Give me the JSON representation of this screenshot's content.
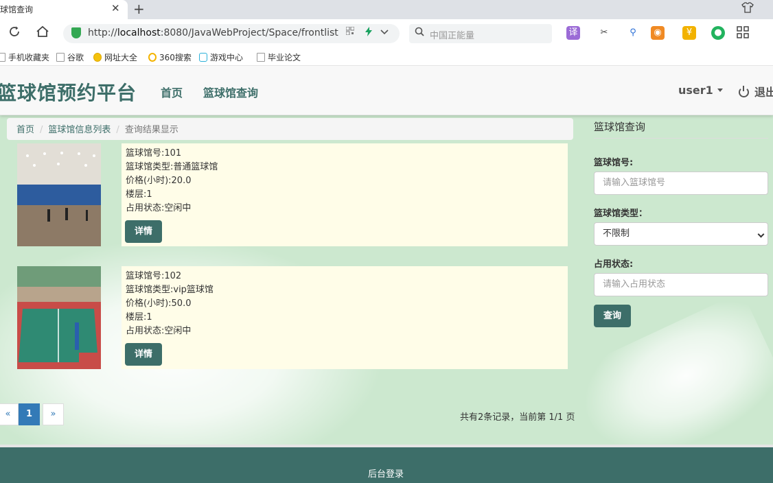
{
  "browser": {
    "tab_title": "球馆查询",
    "close_glyph": "✕",
    "new_tab_glyph": "+",
    "url_prefix": "http://",
    "url_host": "localhost",
    "url_rest": ":8080/JavaWebProject/Space/frontlist",
    "search_placeholder": "中国正能量",
    "bookmarks": [
      "手机收藏夹",
      "谷歌",
      "网址大全",
      "360搜索",
      "游戏中心",
      "毕业论文"
    ]
  },
  "header": {
    "brand": "篮球馆预约平台",
    "nav": [
      "首页",
      "篮球馆查询"
    ],
    "user": "user1",
    "logout": "退出"
  },
  "breadcrumb": {
    "items": [
      "首页",
      "篮球馆信息列表"
    ],
    "current": "查询结果显示",
    "separator": "/"
  },
  "results": [
    {
      "number": "篮球馆号:101",
      "type": "篮球馆类型:普通篮球馆",
      "price": "价格(小时):20.0",
      "floor": "楼层:1",
      "status": "占用状态:空闲中",
      "button": "详情"
    },
    {
      "number": "篮球馆号:102",
      "type": "篮球馆类型:vip篮球馆",
      "price": "价格(小时):50.0",
      "floor": "楼层:1",
      "status": "占用状态:空闲中",
      "button": "详情"
    }
  ],
  "pagination": {
    "prev": "«",
    "current": "1",
    "next": "»",
    "summary": "共有2条记录，当前第 1/1 页"
  },
  "sidebar": {
    "title": "篮球馆查询",
    "number_label": "篮球馆号:",
    "number_placeholder": "请输入篮球馆号",
    "type_label": "篮球馆类型：",
    "type_selected": "不限制",
    "status_label": "占用状态:",
    "status_placeholder": "请输入占用状态",
    "submit": "查询"
  },
  "footer": {
    "admin_link": "后台登录"
  },
  "colors": {
    "brand": "#3d6e69",
    "page_bg": "#cce8cf",
    "card_bg": "#fffde8",
    "pager_active": "#337ab7"
  },
  "icons": [
    "shield-icon",
    "reload-icon",
    "home-icon",
    "search-icon",
    "power-icon",
    "caret-down-icon"
  ]
}
